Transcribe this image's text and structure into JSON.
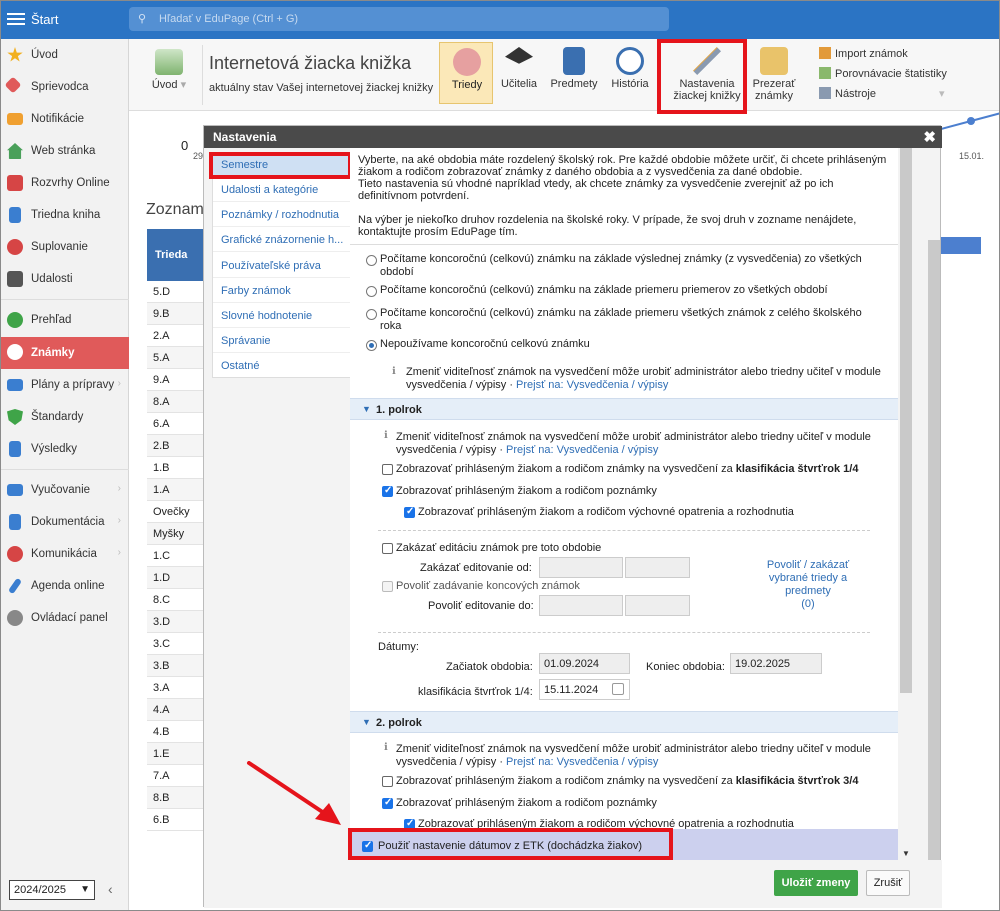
{
  "topbar": {
    "start": "Štart",
    "search_placeholder": "Hľadať v EduPage (Ctrl + G)"
  },
  "sidebar": {
    "items": [
      {
        "label": "Úvod",
        "icon": "star-icon",
        "color": "#f2b01e"
      },
      {
        "label": "Sprievodca",
        "icon": "wand-icon",
        "color": "#e05a5a"
      },
      {
        "label": "Notifikácie",
        "icon": "envelope-icon",
        "color": "#f0a030"
      },
      {
        "label": "Web stránka",
        "icon": "house-icon",
        "color": "#4aa05a"
      },
      {
        "label": "Rozvrhy Online",
        "icon": "grid-icon",
        "color": "#d64545"
      },
      {
        "label": "Triedna kniha",
        "icon": "book-icon",
        "color": "#3a7ed0"
      },
      {
        "label": "Suplovanie",
        "icon": "person-icon",
        "color": "#d64545"
      },
      {
        "label": "Udalosti",
        "icon": "calendar-icon",
        "color": "#555555"
      },
      {
        "label": "Prehľad",
        "icon": "check-circle-icon",
        "color": "#3fa448"
      },
      {
        "label": "Známky",
        "icon": "grade-icon",
        "color": "#ffffff"
      },
      {
        "label": "Plány a prípravy",
        "icon": "briefcase-icon",
        "color": "#3a7ed0"
      },
      {
        "label": "Štandardy",
        "icon": "shield-icon",
        "color": "#3fa448"
      },
      {
        "label": "Výsledky",
        "icon": "bar-chart-icon",
        "color": "#3a7ed0"
      },
      {
        "label": "Vyučovanie",
        "icon": "open-book-icon",
        "color": "#3a7ed0"
      },
      {
        "label": "Dokumentácia",
        "icon": "document-icon",
        "color": "#3a7ed0"
      },
      {
        "label": "Komunikácia",
        "icon": "chat-icon",
        "color": "#d64545"
      },
      {
        "label": "Agenda online",
        "icon": "pen-icon",
        "color": "#3a7ed0"
      },
      {
        "label": "Ovládací panel",
        "icon": "gear-icon",
        "color": "#888888"
      }
    ],
    "year": "2024/2025"
  },
  "ribbon": {
    "uvod": "Úvod",
    "title": "Internetová žiacka knižka",
    "subtitle": "aktuálny stav Vašej internetovej žiackej knižky",
    "triedy": "Triedy",
    "ucitelia": "Učitelia",
    "predmety": "Predmety",
    "historia": "História",
    "nastavenia_1": "Nastavenia",
    "nastavenia_2": "žiackej knižky",
    "prezerat_1": "Prezerať",
    "prezerat_2": "známky",
    "import": "Import známok",
    "porovnavacie": "Porovnávacie štatistiky",
    "nastroje": "Nástroje"
  },
  "background": {
    "zero": "0",
    "d29": "29",
    "d1501": "15.01.",
    "zoznam": "Zoznam",
    "table_header": "Trieda",
    "classes": [
      "5.D",
      "9.B",
      "2.A",
      "5.A",
      "9.A",
      "8.A",
      "6.A",
      "2.B",
      "1.B",
      "1.A",
      "Ovečky",
      "Myšky",
      "1.C",
      "1.D",
      "8.C",
      "3.D",
      "3.C",
      "3.B",
      "3.A",
      "4.A",
      "4.B",
      "1.E",
      "7.A",
      "8.B",
      "6.B"
    ]
  },
  "dialog": {
    "title": "Nastavenia",
    "nav": [
      "Semestre",
      "Udalosti a kategórie",
      "Poznámky / rozhodnutia",
      "Grafické znázornenie h...",
      "Používateľské práva",
      "Farby známok",
      "Slovné hodnotenie",
      "Správanie",
      "Ostatné"
    ],
    "intro_1": "Vyberte, na aké obdobia máte rozdelený školský rok. Pre každé obdobie môžete určiť, či chcete prihláseným",
    "intro_2": "žiakom a rodičom zobrazovať známky z daného obdobia a z vysvedčenia za dané obdobie.",
    "intro_3": "Tieto nastavenia sú vhodné napríklad vtedy, ak chcete známky za vysvedčenie zverejniť až po ich",
    "intro_4": "definitívnom potvrdení.",
    "intro_5": "Na výber je niekoľko druhov rozdelenia na školské roky. V prípade, že svoj druh v zozname nenájdete,",
    "intro_6": "kontaktujte prosím EduPage tím.",
    "radio_1a": "Počítame koncoročnú (celkovú) známku na základe výslednej známky (z vysvedčenia) zo všetkých",
    "radio_1b": "období",
    "radio_2": "Počítame koncoročnú (celkovú) známku na základe priemeru priemerov zo všetkých období",
    "radio_3a": "Počítame koncoročnú (celkovú) známku na základe priemeru všetkých známok z celého školského",
    "radio_3b": "roka",
    "radio_4": "Nepoužívame koncoročnú celkovú známku",
    "info_a": "Zmeniť viditeľnosť známok na vysvedčení môže urobiť administrátor alebo triedny učiteľ v module",
    "info_b": "vysvedčenia / výpisy · ",
    "info_link": "Prejsť na: Vysvedčenia / výpisy",
    "sec1": "1. polrok",
    "sec2": "2. polrok",
    "cb_vysv_1": "Zobrazovať prihláseným žiakom a rodičom známky na vysvedčení za ",
    "cb_vysv_1_bold": "klasifikácia štvrťrok 1/4",
    "cb_vysv_2_bold": "klasifikácia štvrťrok 3/4",
    "cb_poznamky": "Zobrazovať prihláseným žiakom a rodičom poznámky",
    "cb_opatrenia": "Zobrazovať prihláseným žiakom a rodičom výchovné opatrenia a rozhodnutia",
    "cb_zakazat": "Zakázať editáciu známok pre toto obdobie",
    "zakazat_od": "Zakázať editovanie od:",
    "cb_povolit": "Povoliť zadávanie koncových známok",
    "povolit_do": "Povoliť editovanie do:",
    "povolit_link_1": "Povoliť / zakázať",
    "povolit_link_2": "vybrané triedy a",
    "povolit_link_3": "predmety",
    "povolit_link_4": "(0)",
    "datumy": "Dátumy:",
    "zaciatok_label": "Začiatok obdobia:",
    "zaciatok_value": "01.09.2024",
    "koniec_label": "Koniec obdobia:",
    "koniec_value": "19.02.2025",
    "klas_label": "klasifikácia štvrťrok 1/4:",
    "klas_value": "15.11.2024",
    "cb_etk": "Použiť nastavenie dátumov z ETK (dochádzka žiakov)",
    "save": "Uložiť zmeny",
    "cancel": "Zrušiť"
  },
  "colors": {
    "topbar": "#2b74c4",
    "accent": "#2f6eb5",
    "highlight": "#e5141b",
    "save": "#3fa448",
    "active_item": "#e05a5a"
  }
}
